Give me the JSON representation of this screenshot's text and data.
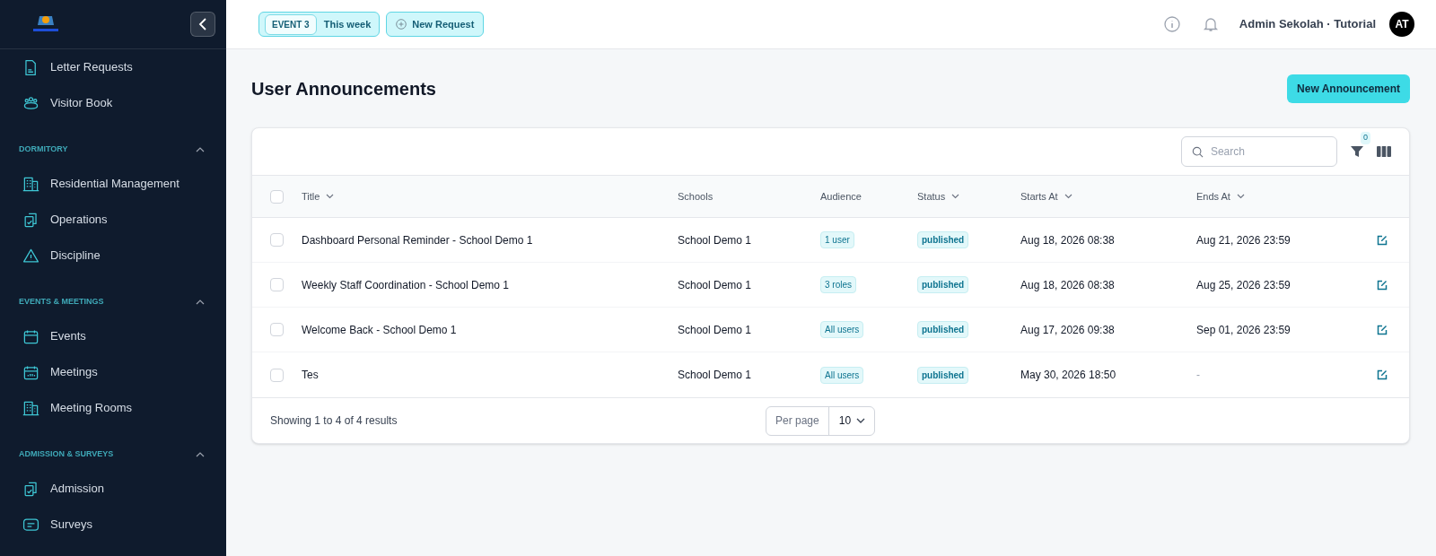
{
  "sidebar": {
    "sections": [
      {
        "items": [
          {
            "label": "Letter Requests"
          },
          {
            "label": "Visitor Book"
          }
        ]
      },
      {
        "heading": "DORMITORY",
        "expanded": true,
        "items": [
          {
            "label": "Residential Management"
          },
          {
            "label": "Operations"
          },
          {
            "label": "Discipline"
          }
        ]
      },
      {
        "heading": "EVENTS & MEETINGS",
        "expanded": true,
        "items": [
          {
            "label": "Events"
          },
          {
            "label": "Meetings"
          },
          {
            "label": "Meeting Rooms"
          }
        ]
      },
      {
        "heading": "ADMISSION & SURVEYS",
        "expanded": true,
        "items": [
          {
            "label": "Admission"
          },
          {
            "label": "Surveys"
          }
        ]
      }
    ]
  },
  "topbar": {
    "event_badge": "EVENT 3",
    "event_label": "This week",
    "new_request": "New Request",
    "user": "Admin Sekolah · Tutorial",
    "avatar": "AT"
  },
  "page": {
    "title": "User Announcements",
    "new_button": "New Announcement"
  },
  "table": {
    "search": {
      "placeholder": "Search"
    },
    "filter_count": "0",
    "columns": [
      {
        "label": "Title",
        "sortable": true
      },
      {
        "label": "Schools",
        "sortable": false
      },
      {
        "label": "Audience",
        "sortable": false
      },
      {
        "label": "Status",
        "sortable": true
      },
      {
        "label": "Starts At",
        "sortable": true
      },
      {
        "label": "Ends At",
        "sortable": true
      }
    ],
    "header_checked": false,
    "rows": [
      {
        "checked": false,
        "title": "Dashboard Personal Reminder - School Demo 1",
        "school": "School Demo 1",
        "audience": "1 user",
        "status": "published",
        "starts": "Aug 18, 2026 08:38",
        "ends": "Aug 21, 2026 23:59"
      },
      {
        "checked": false,
        "title": "Weekly Staff Coordination - School Demo 1",
        "school": "School Demo 1",
        "audience": "3 roles",
        "status": "published",
        "starts": "Aug 18, 2026 08:38",
        "ends": "Aug 25, 2026 23:59"
      },
      {
        "checked": false,
        "title": "Welcome Back - School Demo 1",
        "school": "School Demo 1",
        "audience": "All users",
        "status": "published",
        "starts": "Aug 17, 2026 09:38",
        "ends": "Sep 01, 2026 23:59"
      },
      {
        "checked": false,
        "title": "Tes",
        "school": "School Demo 1",
        "audience": "All users",
        "status": "published",
        "starts": "May 30, 2026 18:50",
        "ends": "-"
      }
    ],
    "footer": {
      "summary": "Showing 1 to 4 of 4 results",
      "per_page_label": "Per page",
      "per_page": "10"
    }
  }
}
